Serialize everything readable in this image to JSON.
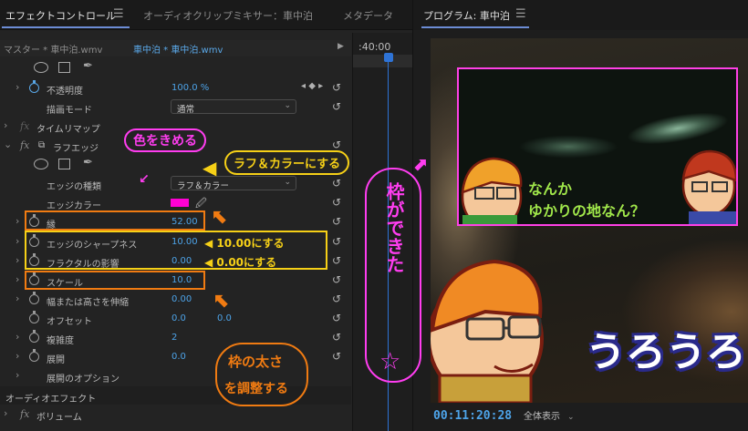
{
  "tabs": {
    "effect_controls": "エフェクトコントロール",
    "audio_mixer": "オーディオクリップミキサー：車中泊",
    "metadata": "メタデータ"
  },
  "source": {
    "master": "マスター * 車中泊.wmv",
    "clip": "車中泊 * 車中泊.wmv"
  },
  "timeline": {
    "time": ":40:00"
  },
  "rows": {
    "opacity_label": "不透明度",
    "opacity_value": "100.0 %",
    "blend_label": "描画モード",
    "blend_value": "通常",
    "time_remap": "タイムリマップ",
    "rough_edges": "ラフエッジ",
    "edge_type_label": "エッジの種類",
    "edge_type_value": "ラフ＆カラー",
    "edge_color_label": "エッジカラー",
    "border_label": "縁",
    "border_value": "52.00",
    "edge_sharpness_label": "エッジのシャープネス",
    "edge_sharpness_value": "10.00",
    "fractal_label": "フラクタルの影響",
    "fractal_value": "0.00",
    "scale_label": "スケール",
    "scale_value": "10.0",
    "stretch_label": "幅または高さを伸縮",
    "stretch_value": "0.00",
    "offset_label": "オフセット",
    "offset_x": "0.0",
    "offset_y": "0.0",
    "complexity_label": "複雑度",
    "complexity_value": "2",
    "evolution_label": "展開",
    "evolution_value": "0.0",
    "evolution_options": "展開のオプション",
    "audio_effects": "オーディオエフェクト",
    "volume": "ボリューム"
  },
  "monitor": {
    "title": "プログラム: 車中泊",
    "timecode": "00:11:20:28",
    "fit": "全体表示"
  },
  "annotations": {
    "color_pick": "色をきめる",
    "rough_color": "ラフ＆カラーにする",
    "set_ten": "10.00にする",
    "set_zero": "0.00にする",
    "frame_width_1": "枠の太さ",
    "frame_width_2": "を調整する",
    "frame_done": "枠ができた",
    "inset_text_1": "なんか",
    "inset_text_2": "ゆかりの地なん？",
    "big_text": "うろうろ"
  },
  "colors": {
    "accent_blue": "#4da3e8",
    "highlight_orange": "#f07b12",
    "highlight_yellow": "#f6d017",
    "edge_color": "#ff00d4",
    "annotation_pink": "#ff3df0"
  }
}
